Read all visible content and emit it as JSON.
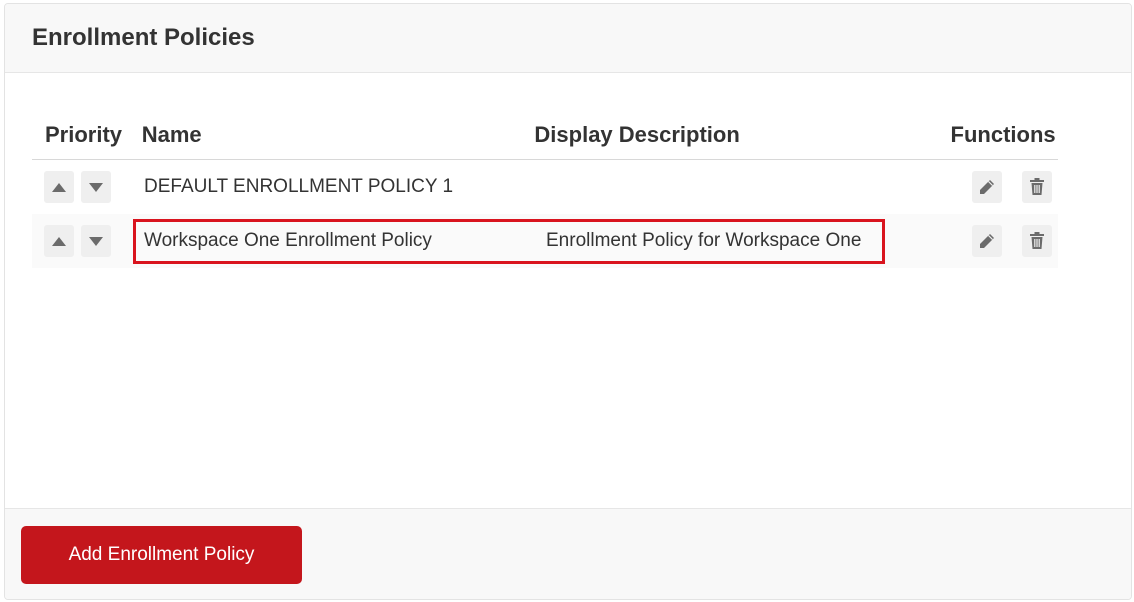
{
  "panel": {
    "title": "Enrollment Policies"
  },
  "table": {
    "columns": {
      "priority": "Priority",
      "name": "Name",
      "description": "Display Description",
      "functions": "Functions"
    },
    "rows": [
      {
        "name": "DEFAULT ENROLLMENT POLICY 1",
        "description": ""
      },
      {
        "name": "Workspace One Enrollment Policy",
        "description": "Enrollment Policy for Workspace One",
        "highlighted": true
      }
    ]
  },
  "icons": {
    "move_up": "triangle-up-icon",
    "move_down": "triangle-down-icon",
    "edit": "pencil-icon",
    "delete": "trash-icon"
  },
  "colors": {
    "accent": "#c4161c",
    "highlight_border": "#d9141e",
    "header_bg": "#f8f8f8",
    "icon_button_bg": "#efefef",
    "icon": "#6b6b6b"
  },
  "footer": {
    "add_button_label": "Add Enrollment Policy"
  }
}
